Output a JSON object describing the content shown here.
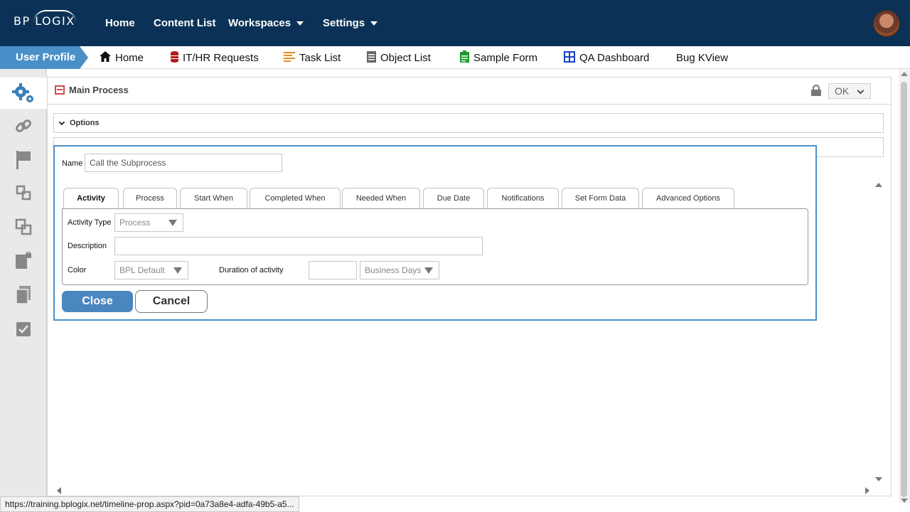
{
  "brand": {
    "logo_text": "BP LOGIX"
  },
  "topnav": {
    "home": "Home",
    "content_list": "Content List",
    "workspaces": "Workspaces",
    "settings": "Settings"
  },
  "subnav": {
    "user_profile": "User Profile",
    "items": [
      {
        "label": "Home",
        "icon": "home-icon"
      },
      {
        "label": "IT/HR Requests",
        "icon": "database-icon"
      },
      {
        "label": "Task List",
        "icon": "list-icon"
      },
      {
        "label": "Object List",
        "icon": "document-icon"
      },
      {
        "label": "Sample Form",
        "icon": "clipboard-icon"
      },
      {
        "label": "QA Dashboard",
        "icon": "dashboard-icon"
      },
      {
        "label": "Bug KView",
        "icon": ""
      }
    ]
  },
  "sidebar": {
    "items": [
      "gears-icon",
      "link-icon",
      "flag-icon",
      "subprocess-icon",
      "copy-icon",
      "locked-document-icon",
      "pages-icon",
      "checklist-icon"
    ]
  },
  "panel": {
    "title": "Main Process",
    "ok_label": "OK",
    "options_section": "Options"
  },
  "dialog": {
    "name_label": "Name",
    "name_value": "Call the Subprocess",
    "tabs": [
      "Activity",
      "Process",
      "Start When",
      "Completed When",
      "Needed When",
      "Due Date",
      "Notifications",
      "Set Form Data",
      "Advanced Options"
    ],
    "activity_type_label": "Activity Type",
    "activity_type_value": "Process",
    "description_label": "Description",
    "description_value": "",
    "color_label": "Color",
    "color_value": "BPL Default",
    "duration_label": "Duration of activity",
    "duration_value": "",
    "duration_unit": "Business Days",
    "close_label": "Close",
    "cancel_label": "Cancel"
  },
  "status_url": "https://training.bplogix.net/timeline-prop.aspx?pid=0a73a8e4-adfa-49b5-a5...",
  "colors": {
    "topbar": "#0b3256",
    "accent": "#4a90c8"
  }
}
